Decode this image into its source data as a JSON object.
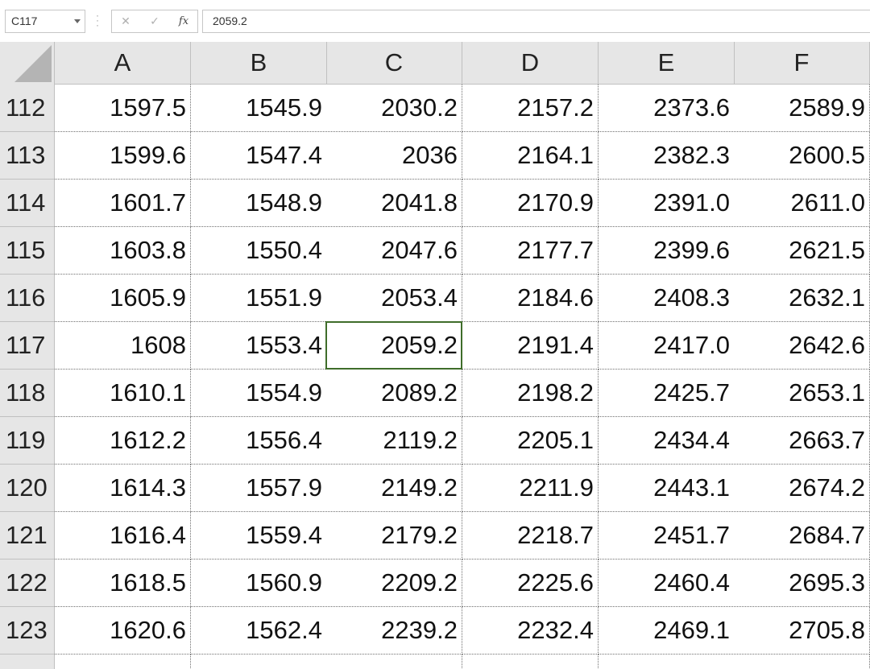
{
  "name_box": {
    "value": "C117"
  },
  "formula_bar": {
    "cancel_icon": "close-icon",
    "enter_icon": "check-icon",
    "fx_label": "fx",
    "value": "2059.2"
  },
  "columns": [
    "A",
    "B",
    "C",
    "D",
    "E",
    "F"
  ],
  "rows": [
    {
      "row": "112",
      "cells": [
        "1597.5",
        "1545.9",
        "2030.2",
        "2157.2",
        "2373.6",
        "2589.9"
      ]
    },
    {
      "row": "113",
      "cells": [
        "1599.6",
        "1547.4",
        "2036",
        "2164.1",
        "2382.3",
        "2600.5"
      ]
    },
    {
      "row": "114",
      "cells": [
        "1601.7",
        "1548.9",
        "2041.8",
        "2170.9",
        "2391.0",
        "2611.0"
      ]
    },
    {
      "row": "115",
      "cells": [
        "1603.8",
        "1550.4",
        "2047.6",
        "2177.7",
        "2399.6",
        "2621.5"
      ]
    },
    {
      "row": "116",
      "cells": [
        "1605.9",
        "1551.9",
        "2053.4",
        "2184.6",
        "2408.3",
        "2632.1"
      ]
    },
    {
      "row": "117",
      "cells": [
        "1608",
        "1553.4",
        "2059.2",
        "2191.4",
        "2417.0",
        "2642.6"
      ]
    },
    {
      "row": "118",
      "cells": [
        "1610.1",
        "1554.9",
        "2089.2",
        "2198.2",
        "2425.7",
        "2653.1"
      ]
    },
    {
      "row": "119",
      "cells": [
        "1612.2",
        "1556.4",
        "2119.2",
        "2205.1",
        "2434.4",
        "2663.7"
      ]
    },
    {
      "row": "120",
      "cells": [
        "1614.3",
        "1557.9",
        "2149.2",
        "2211.9",
        "2443.1",
        "2674.2"
      ]
    },
    {
      "row": "121",
      "cells": [
        "1616.4",
        "1559.4",
        "2179.2",
        "2218.7",
        "2451.7",
        "2684.7"
      ]
    },
    {
      "row": "122",
      "cells": [
        "1618.5",
        "1560.9",
        "2209.2",
        "2225.6",
        "2460.4",
        "2695.3"
      ]
    },
    {
      "row": "123",
      "cells": [
        "1620.6",
        "1562.4",
        "2239.2",
        "2232.4",
        "2469.1",
        "2705.8"
      ]
    }
  ],
  "selected_cell": {
    "column": "C",
    "row": "117"
  }
}
